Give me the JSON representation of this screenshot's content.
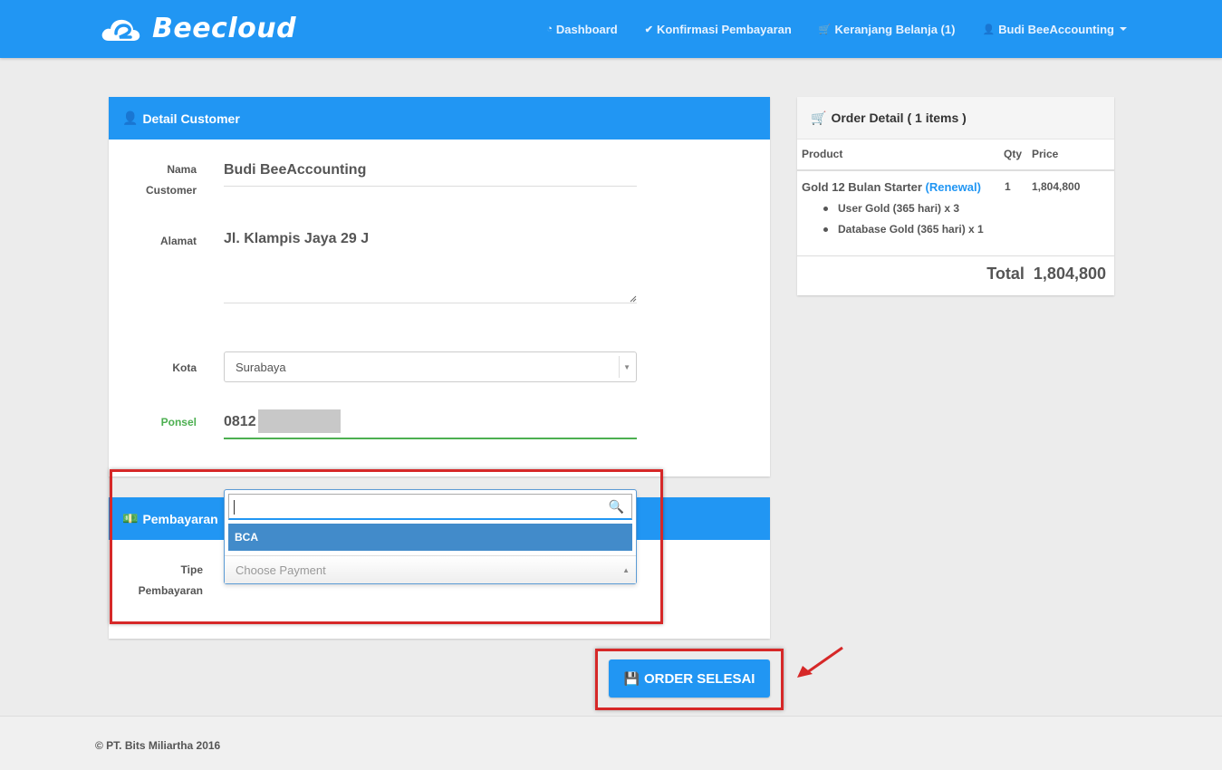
{
  "brand": {
    "name": "Beecloud"
  },
  "nav": {
    "dashboard": "Dashboard",
    "konfirmasi": "Konfirmasi Pembayaran",
    "keranjang": "Keranjang Belanja (1)",
    "user": "Budi BeeAccounting"
  },
  "customer": {
    "title": "Detail Customer",
    "nama_label_1": "Nama",
    "nama_label_2": "Customer",
    "nama_value": "Budi BeeAccounting",
    "alamat_label": "Alamat",
    "alamat_value": "Jl. Klampis Jaya 29 J",
    "kota_label": "Kota",
    "kota_value": "Surabaya",
    "ponsel_label": "Ponsel",
    "ponsel_value": "0812"
  },
  "payment": {
    "title": "Pembayaran",
    "tipe_label_1": "Tipe",
    "tipe_label_2": "Pembayaran",
    "option": "BCA",
    "placeholder": "Choose Payment"
  },
  "order": {
    "title": "Order Detail ( 1 items )",
    "col_product": "Product",
    "col_qty": "Qty",
    "col_price": "Price",
    "product_name": "Gold 12 Bulan Starter",
    "product_tag": "(Renewal)",
    "qty": "1",
    "price": "1,804,800",
    "sub_items": [
      "User Gold (365 hari) x 3",
      "Database Gold (365 hari) x 1"
    ],
    "total_label": "Total",
    "total_value": "1,804,800"
  },
  "actions": {
    "order_button": "ORDER SELESAI"
  },
  "footer": {
    "copyright": "© PT. Bits Miliartha 2016"
  },
  "colors": {
    "primary": "#2196f3",
    "highlight": "#d62828",
    "valid": "#4caf50"
  }
}
